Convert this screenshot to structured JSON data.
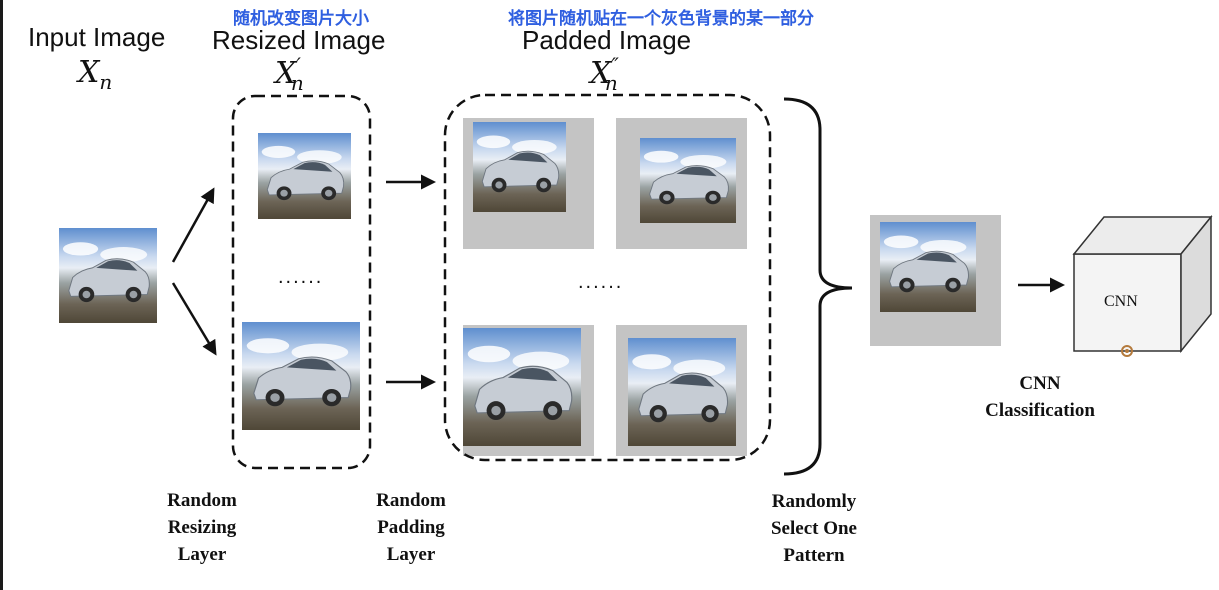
{
  "columns": {
    "input": {
      "title": "Input Image",
      "symbol": "X",
      "subscript": "n",
      "prime": ""
    },
    "resized": {
      "title": "Resized Image",
      "symbol": "X",
      "subscript": "n",
      "prime": "′",
      "note": "随机改变图片大小"
    },
    "padded": {
      "title": "Padded Image",
      "symbol": "X",
      "subscript": "n",
      "prime": "″",
      "note": "将图片随机贴在一个灰色背景的某一部分"
    }
  },
  "ellipsis": "......",
  "layers": {
    "resizing": [
      "Random",
      "Resizing",
      "Layer"
    ],
    "padding": [
      "Random",
      "Padding",
      "Layer"
    ],
    "select": [
      "Randomly",
      "Select One",
      "Pattern"
    ]
  },
  "cnn": {
    "box_label": "CNN",
    "caption": [
      "CNN",
      "Classification"
    ]
  },
  "colors": {
    "annotation": "#2f5fe0",
    "pad_background": "#c4c4c4",
    "line": "#111111"
  }
}
